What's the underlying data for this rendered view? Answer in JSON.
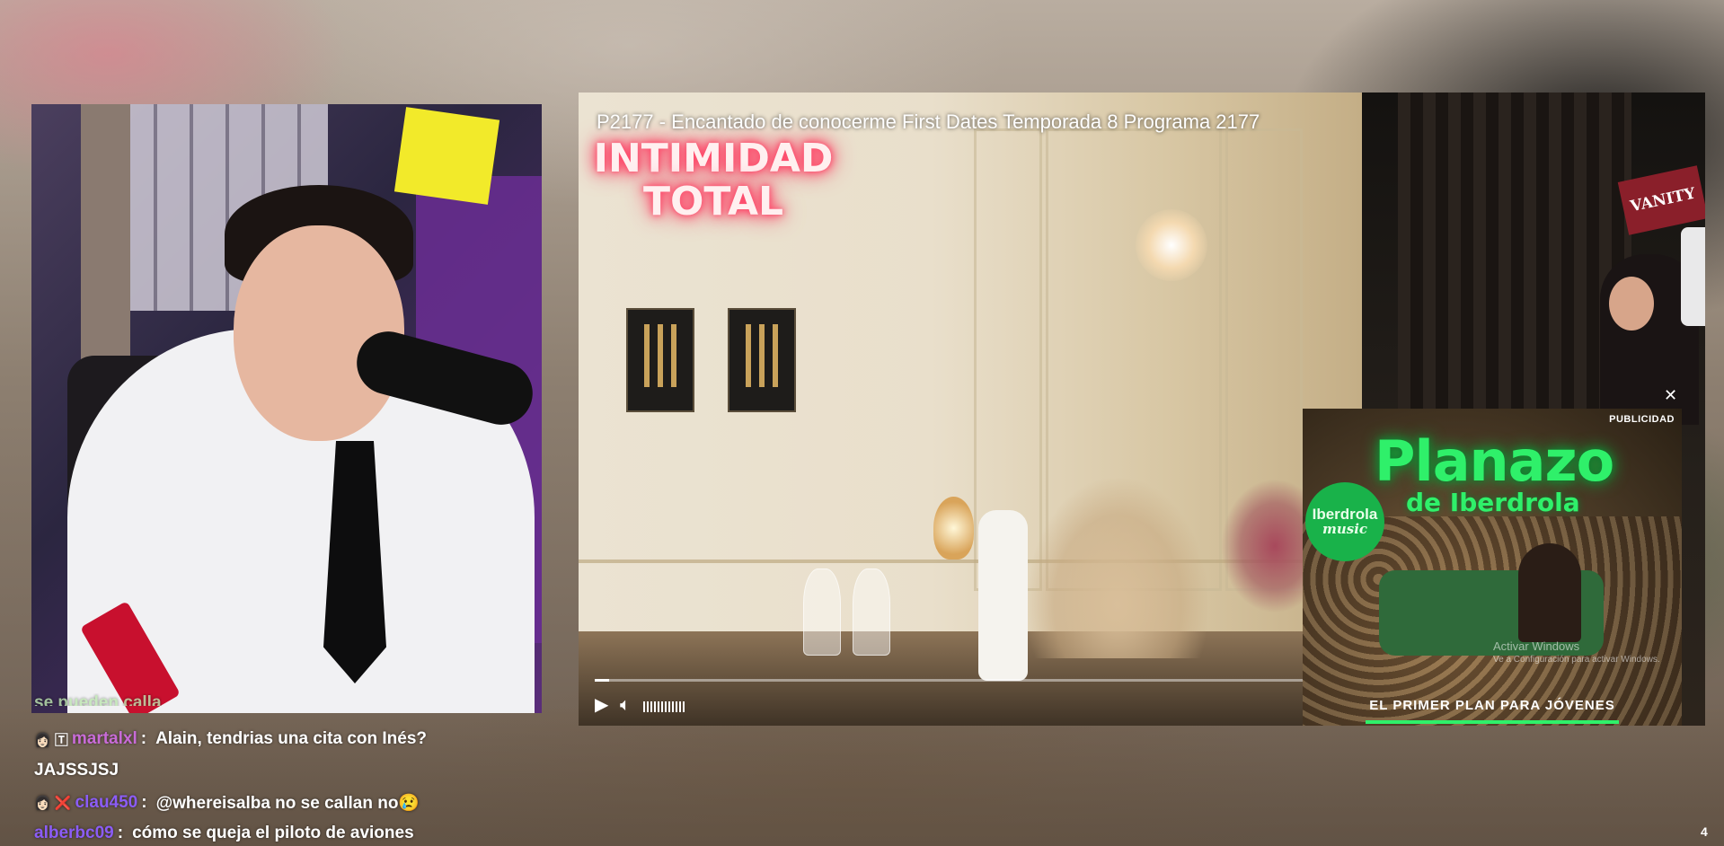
{
  "video": {
    "title": "P2177 - Encantado de conocerme First Dates Temporada 8 Programa 2177",
    "neon_sign": [
      "INTIMIDAD",
      "TOTAL"
    ],
    "backstage_sign": "VANITY",
    "progress_fraction": 0.02,
    "play_icon": "play-icon",
    "volume_icon": "volume-icon"
  },
  "ad": {
    "label": "PUBLICIDAD",
    "title": "Planazo",
    "subtitle": "de Iberdrola",
    "logo_line1": "Iberdrola",
    "logo_line2": "music",
    "tagline": "EL PRIMER PLAN PARA JÓVENES",
    "close_icon": "✕",
    "accent_color": "#2ff06a"
  },
  "windows_watermark": {
    "line1": "Activar Windows",
    "line2": "Ve a Configuración para activar Windows."
  },
  "chat": {
    "cutoff_text": "se pueden calla",
    "messages": [
      {
        "user": "martalxl",
        "sep": ":",
        "text": "Alain, tendrias una cita con Inés?",
        "badges": "👩🏻 🅃"
      },
      {
        "user": "",
        "sep": "",
        "text": "JAJSSJSJ",
        "badges": ""
      },
      {
        "user": "clau450",
        "sep": ":",
        "text": "@whereisalba no se callan no😢",
        "badges": "👩🏻 ❌"
      },
      {
        "user": "alberbc09",
        "sep": ":",
        "text": "cómo se queja el piloto de aviones",
        "badges": ""
      }
    ]
  },
  "page_number": "4"
}
